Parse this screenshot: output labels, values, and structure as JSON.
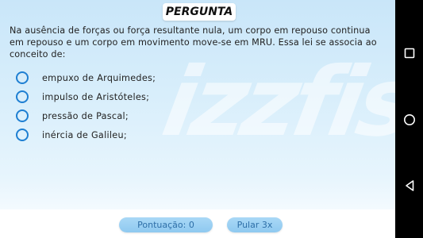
{
  "header": {
    "title": "PERGUNTA"
  },
  "question": {
    "text": "Na ausência de forças ou força resultante nula, um corpo em repouso continua em repouso e um corpo em movimento move-se em MRU. Essa lei se associa ao conceito de:"
  },
  "options": [
    {
      "label": "empuxo de Arquimedes;"
    },
    {
      "label": "impulso de Aristóteles;"
    },
    {
      "label": "pressão de Pascal;"
    },
    {
      "label": "inércia de Galileu;"
    }
  ],
  "footer": {
    "score_label": "Pontuação: 0",
    "skip_label": "Pular 3x"
  },
  "nav": {
    "recent_icon": "square-recents-icon",
    "home_icon": "circle-home-icon",
    "back_icon": "triangle-back-icon"
  },
  "colors": {
    "accent": "#1e7fd2",
    "pill": "#9dd1f3",
    "pill_text": "#2e6fa8"
  }
}
